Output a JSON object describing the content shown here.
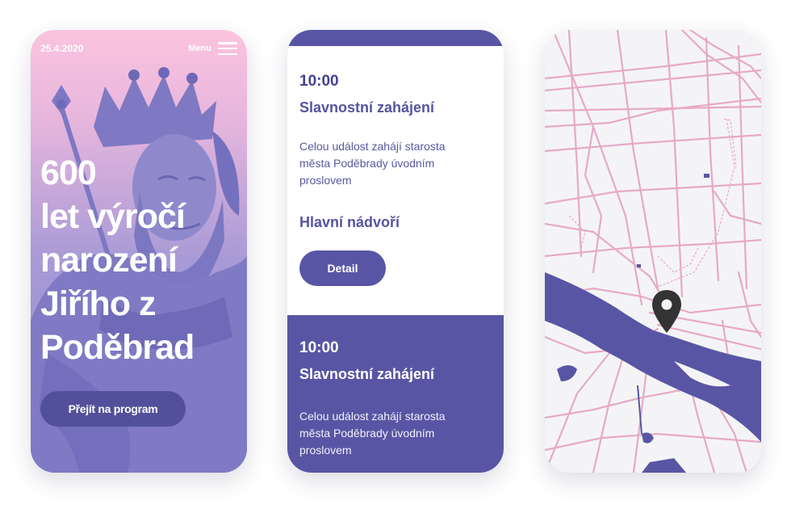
{
  "colors": {
    "brand_purple": "#5856a4",
    "dark_purple": "#52509a",
    "pink": "#fbc4de",
    "map_roads": "#e7a9c6"
  },
  "screen1": {
    "date": "25.4.2020",
    "menu_label": "Menu",
    "menu_icon": "hamburger-icon",
    "hero_lines": [
      "600",
      "let výročí",
      "narození",
      "Jiřího z",
      "Poděbrad"
    ],
    "button_label": "Přejít na program"
  },
  "screen2": {
    "event1": {
      "time": "10:00",
      "title": "Slavnostní zahájení",
      "description_lines": [
        "Celou událost zahájí starosta",
        "města Poděbrady úvodním",
        "proslovem"
      ],
      "place": "Hlavní nádvoří",
      "button_label": "Detail"
    },
    "event2": {
      "time": "10:00",
      "title": "Slavnostní zahájení",
      "description_lines": [
        "Celou událost zahájí starosta",
        "města Poděbrady úvodním",
        "proslovem"
      ]
    }
  },
  "screen3": {
    "marker_icon": "map-pin-icon"
  }
}
